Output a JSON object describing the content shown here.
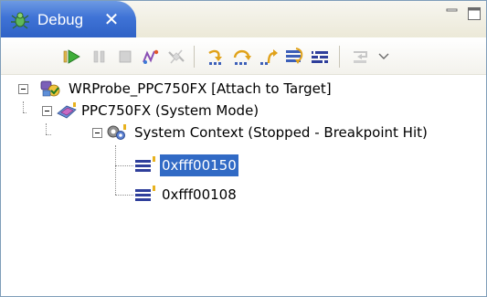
{
  "view": {
    "tab_label": "Debug",
    "tab_icon": "debug-bug-icon",
    "close_icon": "close-icon"
  },
  "toolbar": {
    "buttons": [
      {
        "name": "resume-button",
        "icon": "resume-icon"
      },
      {
        "name": "suspend-button",
        "icon": "suspend-icon"
      },
      {
        "name": "terminate-button",
        "icon": "terminate-icon"
      },
      {
        "name": "connect-button",
        "icon": "connect-icon"
      },
      {
        "name": "disconnect-button",
        "icon": "disconnect-icon"
      },
      {
        "name": "step-into-button",
        "icon": "step-into-icon"
      },
      {
        "name": "step-over-button",
        "icon": "step-over-icon"
      },
      {
        "name": "step-return-button",
        "icon": "step-return-icon"
      },
      {
        "name": "drop-to-frame-button",
        "icon": "drop-to-frame-icon"
      },
      {
        "name": "instruction-stepping-button",
        "icon": "instruction-stepping-icon"
      },
      {
        "name": "use-step-filters-button",
        "icon": "step-filters-icon"
      },
      {
        "name": "view-menu-button",
        "icon": "chevron-down-icon"
      }
    ]
  },
  "tree": {
    "target": "WRProbe_PPC750FX [Attach to Target]",
    "core": "PPC750FX (System Mode)",
    "context": "System Context (Stopped - Breakpoint Hit)",
    "frames": [
      "0xfff00150",
      "0xfff00108"
    ]
  },
  "colors": {
    "tab_blue": "#3f73d6",
    "selection": "#316ac5",
    "border": "#7f9db9"
  }
}
